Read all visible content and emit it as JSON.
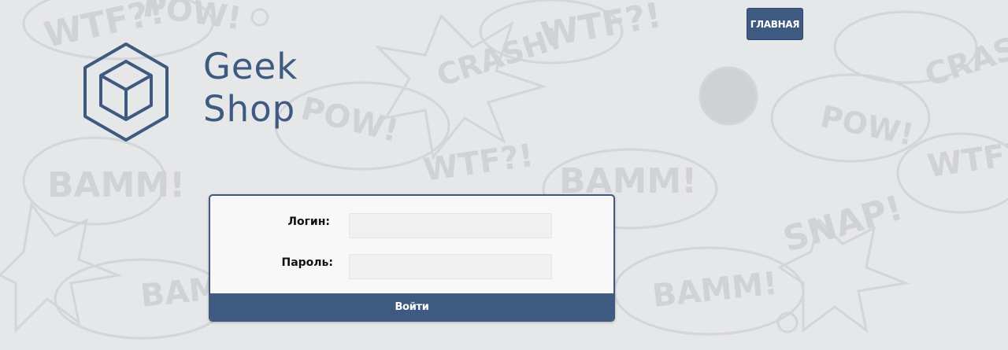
{
  "header": {
    "home_button_label": "ГЛАВНАЯ"
  },
  "logo": {
    "line1": "Geek",
    "line2": "Shop",
    "icon": "cube-icon"
  },
  "login_form": {
    "login_label": "Логин:",
    "login_value": "",
    "password_label": "Пароль:",
    "password_value": "",
    "submit_label": "Войти"
  },
  "background": {
    "comic_words": [
      "WTF?!",
      "POW!",
      "CRASH!",
      "BAMM!",
      "SNAP!"
    ]
  },
  "colors": {
    "accent": "#3e5a80",
    "background": "#e6e7e9",
    "card": "#f8f8f8"
  }
}
